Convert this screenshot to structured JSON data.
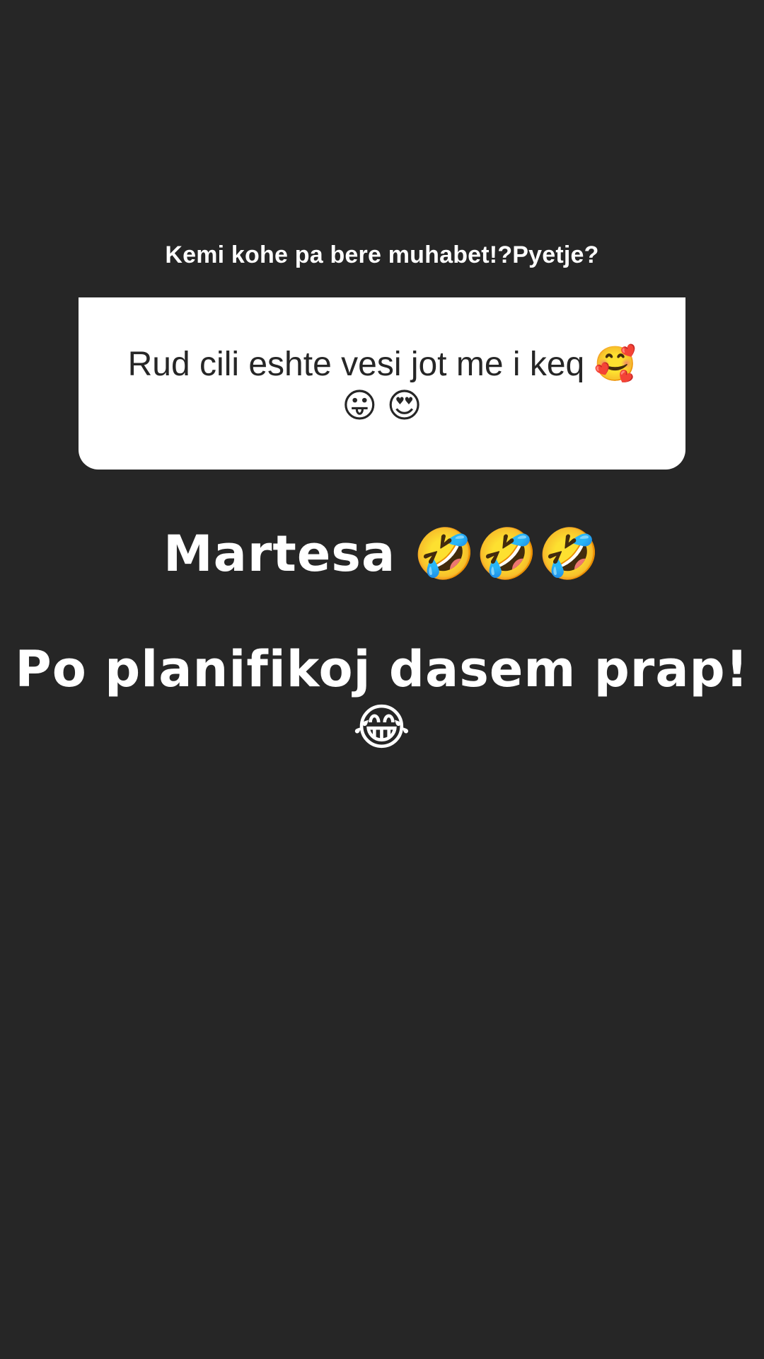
{
  "story": {
    "background_color": "#262626",
    "question_prompt": "Kemi kohe pa bere muhabet!?Pyetje?",
    "question_card": {
      "text": "Rud cili eshte vesi jot me i keq 🥰 😛 😍",
      "background_color": "#ffffff"
    },
    "answer": {
      "line_1": "Martesa 🤣🤣🤣",
      "line_2": "Po planifikoj dasem prap! 😂"
    }
  }
}
